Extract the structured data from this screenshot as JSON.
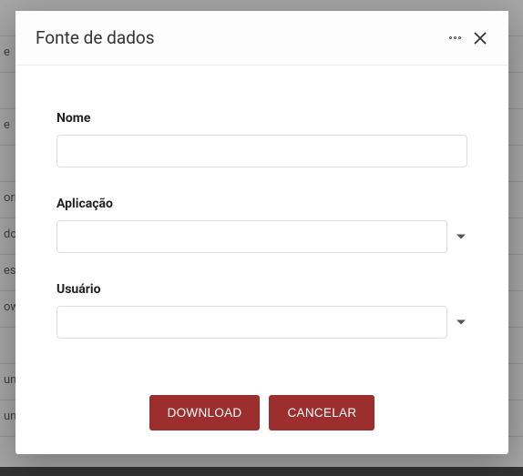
{
  "modal": {
    "title": "Fonte de dados"
  },
  "form": {
    "name": {
      "label": "Nome",
      "value": ""
    },
    "application": {
      "label": "Aplicação",
      "value": ""
    },
    "user": {
      "label": "Usuário",
      "value": ""
    }
  },
  "buttons": {
    "download": "DOWNLOAD",
    "cancel": "CANCELAR"
  },
  "colors": {
    "primary": "#9d2e2e"
  },
  "background_rows": [
    "",
    "e",
    "",
    "e",
    "",
    "orm",
    "do:",
    "es",
    "ow",
    "",
    "um",
    "um"
  ]
}
